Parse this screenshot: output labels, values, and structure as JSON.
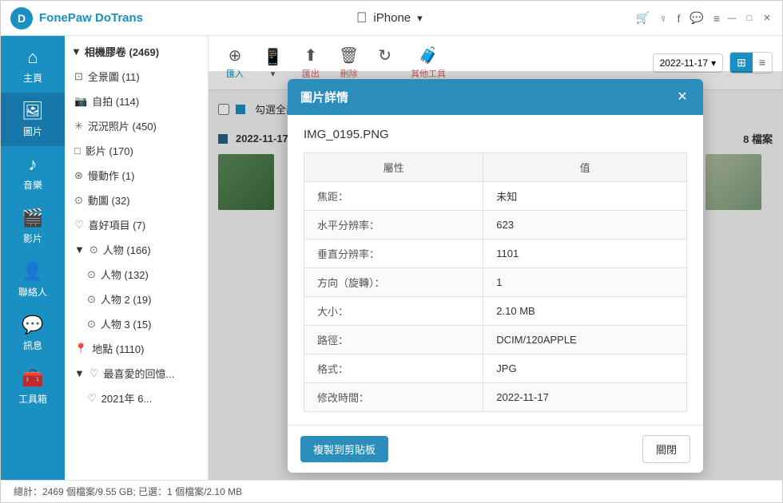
{
  "app": {
    "name": "FonePaw DoTrans",
    "logo_letter": "D"
  },
  "title_bar": {
    "device_name": "iPhone",
    "dropdown_icon": "▾",
    "actions": [
      "🛒",
      "♀",
      "f",
      "💬",
      "≡",
      "—",
      "□",
      "✕"
    ]
  },
  "sidebar": {
    "items": [
      {
        "id": "home",
        "label": "主頁",
        "icon": "⌂"
      },
      {
        "id": "photos",
        "label": "圖片",
        "icon": "🖼",
        "active": true
      },
      {
        "id": "music",
        "label": "音樂",
        "icon": "♪"
      },
      {
        "id": "videos",
        "label": "影片",
        "icon": "📹"
      },
      {
        "id": "contacts",
        "label": "聯絡人",
        "icon": "👤"
      },
      {
        "id": "messages",
        "label": "訊息",
        "icon": "💬"
      },
      {
        "id": "toolbox",
        "label": "工具箱",
        "icon": "🧰"
      }
    ]
  },
  "category": {
    "header": "相機膠卷 (2469)",
    "items": [
      {
        "label": "全景圖 (11)",
        "icon": "⊡"
      },
      {
        "label": "自拍 (114)",
        "icon": "📷"
      },
      {
        "label": "況況照片 (450)",
        "icon": "✳"
      },
      {
        "label": "影片 (170)",
        "icon": "□"
      },
      {
        "label": "慢動作 (1)",
        "icon": "⊛"
      },
      {
        "label": "動圖 (32)",
        "icon": "⊙"
      },
      {
        "label": "喜好項目 (7)",
        "icon": "♡"
      },
      {
        "label": "人物 (166)",
        "icon": "⊙",
        "expanded": true
      },
      {
        "label": "人物 (132)",
        "icon": "⊙",
        "sub": true
      },
      {
        "label": "人物 2 (19)",
        "icon": "⊙",
        "sub": true
      },
      {
        "label": "人物 3 (15)",
        "icon": "⊙",
        "sub": true
      },
      {
        "label": "地點 (1110)",
        "icon": "📍"
      },
      {
        "label": "最喜愛的回憶...",
        "icon": "♡",
        "expanded": true
      },
      {
        "label": "2021年 6...",
        "icon": "♡",
        "sub": true
      }
    ]
  },
  "toolbar": {
    "add_label": "匯入",
    "export_label": "匯出",
    "delete_label": "刪除",
    "sync_label": "同步",
    "other_label": "其他工具",
    "date": "2022-11-17",
    "view_grid": "⊞",
    "view_list": "≡"
  },
  "photo_area": {
    "select_all": "勾選全部(2469)",
    "date_group": "2022-11-17",
    "file_count": "8 檔案"
  },
  "modal": {
    "title": "圖片詳情",
    "filename": "IMG_0195.PNG",
    "table_headers": [
      "屬性",
      "值"
    ],
    "rows": [
      {
        "attr": "焦距：",
        "value": "未知"
      },
      {
        "attr": "水平分辨率：",
        "value": "623"
      },
      {
        "attr": "垂直分辨率：",
        "value": "1101"
      },
      {
        "attr": "方向（旋轉）：",
        "value": "1"
      },
      {
        "attr": "大小：",
        "value": "2.10 MB"
      },
      {
        "attr": "路徑：",
        "value": "DCIM/120APPLE"
      },
      {
        "attr": "格式：",
        "value": "JPG"
      },
      {
        "attr": "修改時間：",
        "value": "2022-11-17"
      }
    ],
    "copy_button": "複製到剪貼板",
    "close_button": "關閉"
  },
  "status_bar": {
    "text": "總計：2469 個檔案/9.55 GB; 已選：1 個檔案/2.10 MB"
  }
}
